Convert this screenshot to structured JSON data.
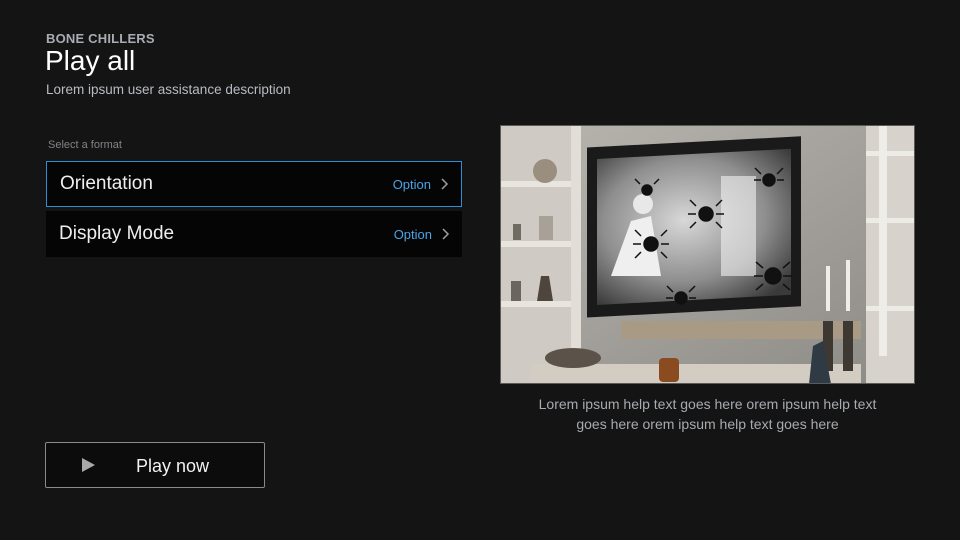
{
  "header": {
    "eyebrow": "BONE CHILLERS",
    "title": "Play all",
    "description": "Lorem ipsum user assistance description"
  },
  "format": {
    "section_label": "Select a format",
    "options": [
      {
        "label": "Orientation",
        "value": "Option",
        "focused": true
      },
      {
        "label": "Display Mode",
        "value": "Option",
        "focused": false
      }
    ]
  },
  "preview": {
    "image": "living-room-tv-spiders-thumbnail",
    "help_text_line1": "Lorem ipsum help text goes here orem ipsum help text",
    "help_text_line2": "goes here orem ipsum help text goes here"
  },
  "actions": {
    "play_label": "Play now",
    "play_icon": "play-icon"
  },
  "colors": {
    "background": "#141414",
    "accent": "#2a8fd6",
    "option_value": "#4aa3e6"
  }
}
